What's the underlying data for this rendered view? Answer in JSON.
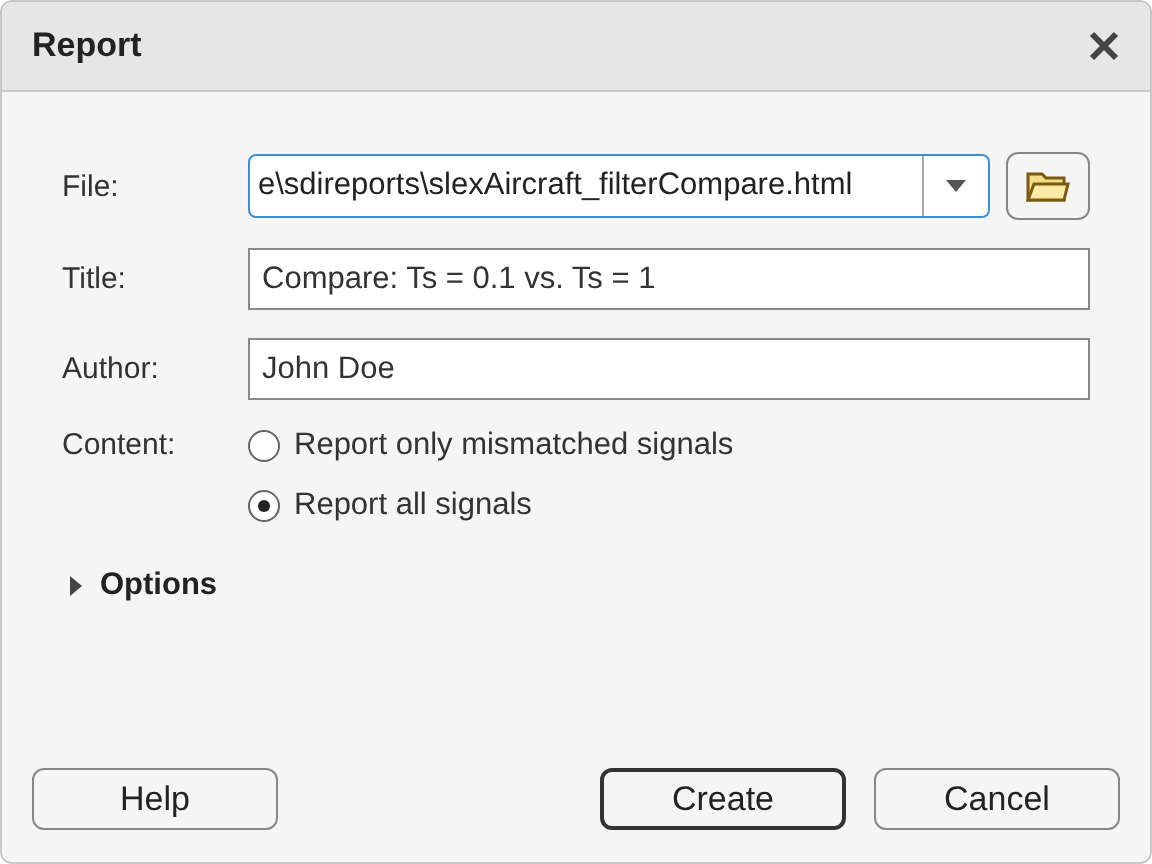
{
  "window": {
    "title": "Report"
  },
  "file": {
    "label": "File:",
    "value": "e\\sdireports\\slexAircraft_filterCompare.html",
    "focused": true
  },
  "fields": [
    {
      "label": "Title:",
      "value": "Compare: Ts = 0.1 vs. Ts = 1"
    },
    {
      "label": "Author:",
      "value": "John Doe"
    }
  ],
  "content": {
    "label": "Content:",
    "options": [
      {
        "label": "Report only mismatched signals",
        "selected": false
      },
      {
        "label": "Report all signals",
        "selected": true
      }
    ]
  },
  "options": {
    "label": "Options",
    "expanded": false
  },
  "buttons": [
    {
      "label": "Help",
      "kind": "help"
    },
    {
      "label": "Create",
      "kind": "default"
    },
    {
      "label": "Cancel",
      "kind": "normal"
    }
  ]
}
